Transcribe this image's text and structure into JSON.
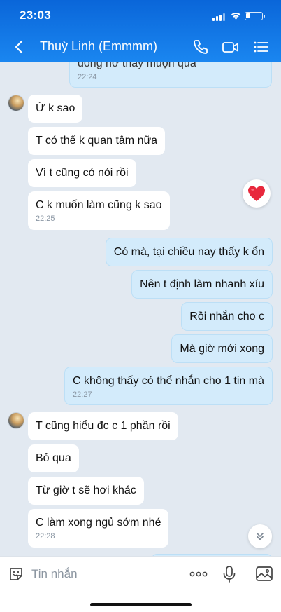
{
  "status_bar": {
    "time": "23:03"
  },
  "header": {
    "title": "Thuỳ Linh (Emmmm)"
  },
  "messages": [
    {
      "side": "out",
      "text": "đông hơ thấy muộn quá",
      "time": "22:24"
    },
    {
      "side": "in",
      "text": "Ừ k sao",
      "time": ""
    },
    {
      "side": "in",
      "text": "T có thể k quan tâm nữa",
      "time": ""
    },
    {
      "side": "in",
      "text": "Vì t cũng có nói rồi",
      "time": ""
    },
    {
      "side": "in",
      "text": "C k muốn làm cũng k sao",
      "time": "22:25"
    },
    {
      "side": "out",
      "text": "Có mà, tại chiều nay thấy k ổn",
      "time": ""
    },
    {
      "side": "out",
      "text": "Nên t định làm nhanh xíu",
      "time": ""
    },
    {
      "side": "out",
      "text": "Rồi nhắn cho c",
      "time": ""
    },
    {
      "side": "out",
      "text": "Mà giờ mới xong",
      "time": ""
    },
    {
      "side": "out",
      "text": "C không thấy có thể nhắn cho 1 tin mà",
      "time": "22:27"
    },
    {
      "side": "in",
      "text": "T cũng hiểu đc c 1 phần rồi",
      "time": ""
    },
    {
      "side": "in",
      "text": "Bỏ qua",
      "time": ""
    },
    {
      "side": "in",
      "text": "Từ giờ t sẽ hơi khác",
      "time": ""
    },
    {
      "side": "in",
      "text": "C làm xong ngủ sớm nhé",
      "time": "22:28"
    }
  ],
  "reaction": {
    "icon": "heart-icon",
    "color": "#e8283c"
  },
  "input": {
    "placeholder": "Tin nhắn"
  },
  "colors": {
    "header": "#0a66d9",
    "chat_bg": "#e2e9f1",
    "outgoing": "#d3ebfb",
    "incoming": "#ffffff"
  }
}
